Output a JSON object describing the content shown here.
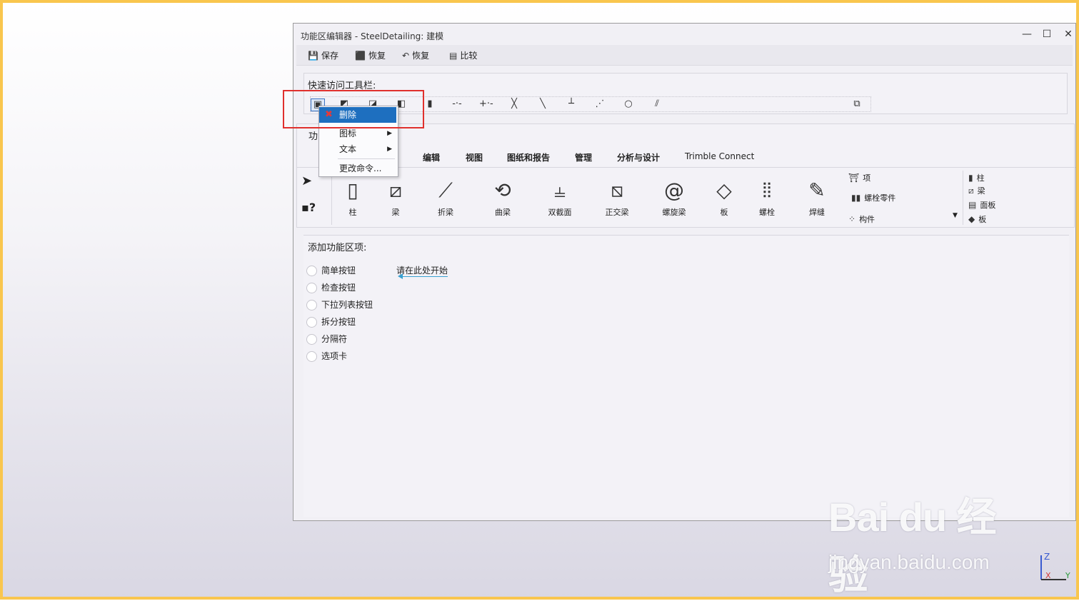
{
  "window": {
    "title": "功能区编辑器 - SteelDetailing: 建模",
    "controls": {
      "minimize": "—",
      "maximize": "☐",
      "close": "✕"
    }
  },
  "toolbar": {
    "save": "保存",
    "restore1": "恢复",
    "restore2": "恢复",
    "compare": "比较"
  },
  "qat": {
    "label": "快速访问工具栏:"
  },
  "context_menu": {
    "delete": "删除",
    "icon": "图标",
    "text": "文本",
    "change_command": "更改命令..."
  },
  "ribbon": {
    "section_label_partial": "功",
    "tabs": [
      "编辑",
      "视图",
      "图纸和报告",
      "管理",
      "分析与设计",
      "Trimble Connect"
    ],
    "buttons": [
      "柱",
      "梁",
      "折梁",
      "曲梁",
      "双截面",
      "正交梁",
      "螺旋梁",
      "板",
      "螺栓",
      "焊缝"
    ],
    "small_items": {
      "item": "项",
      "bolt_parts": "螺栓零件",
      "component": "构件"
    },
    "right_items": [
      "柱",
      "梁",
      "面板",
      "板"
    ]
  },
  "add_section": {
    "label": "添加功能区项:",
    "options": [
      "简单按钮",
      "检查按钮",
      "下拉列表按钮",
      "拆分按钮",
      "分隔符",
      "选项卡"
    ],
    "hint": "请在此处开始"
  },
  "watermark": {
    "logo": "Bai du 经验",
    "site": "jingyan.baidu.com"
  },
  "axis": {
    "z": "Z",
    "x": "X",
    "y": "Y"
  }
}
